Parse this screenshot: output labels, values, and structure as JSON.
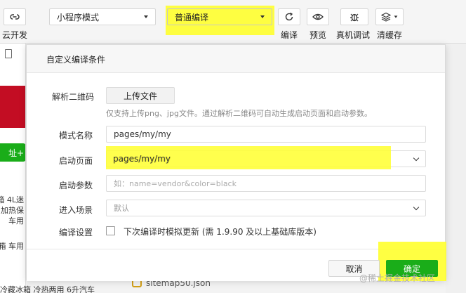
{
  "toolbar": {
    "cloud_dev_label": "云开发",
    "mode_select_value": "小程序模式",
    "compile_select_value": "普通编译",
    "compile_label": "编译",
    "preview_label": "预览",
    "remote_debug_label": "真机调试",
    "clear_cache_label": "清缓存"
  },
  "background": {
    "green_button_text": "址+",
    "lines": [
      "箱 4L迷",
      "加热保",
      "车用",
      "箱 车用"
    ],
    "bottom_text": "冷藏冰箱 冷热两用 6升汽车",
    "file_name": "sitemap50.json"
  },
  "dialog": {
    "title": "自定义编译条件",
    "qrcode_label": "解析二维码",
    "upload_button": "上传文件",
    "upload_hint": "仅支持上传png、jpg文件。通过解析二维码可自动生成启动页面和启动参数。",
    "mode_name_label": "模式名称",
    "mode_name_value": "pages/my/my",
    "start_page_label": "启动页面",
    "start_page_value": "pages/my/my",
    "start_params_label": "启动参数",
    "start_params_placeholder": "如：name=vendor&color=black",
    "scene_label": "进入场景",
    "scene_value": "默认",
    "compile_settings_label": "编译设置",
    "compile_settings_checkbox_label": "下次编译时模拟更新 (需 1.9.90 及以上基础库版本)",
    "cancel_button": "取消",
    "ok_button": "确定"
  },
  "watermark": "@稀土掘金技术社区",
  "colors": {
    "highlight": "#ffff2e",
    "primary_green": "#1aad19",
    "brand_red": "#c30d23"
  }
}
